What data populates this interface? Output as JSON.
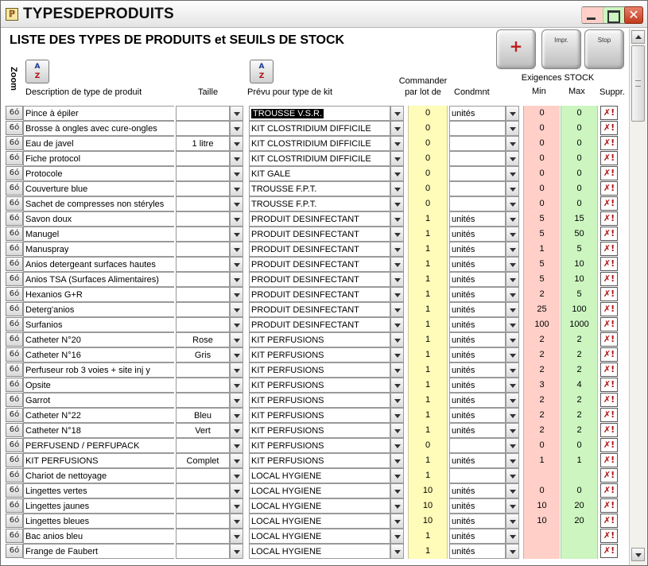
{
  "window": {
    "title": "TYPESDEPRODUITS",
    "close_glyph": "✕"
  },
  "header": {
    "title": "LISTE DES TYPES DE PRODUITS et SEUILS DE STOCK",
    "add_label": "+",
    "print_label": "Impr.",
    "stop_label": "Stop"
  },
  "columns": {
    "zoom": "Zoom",
    "description": "Description de type de produit",
    "taille": "Taille",
    "kit": "Prévu pour type de kit",
    "commander_1": "Commander",
    "commander_2": "par lot de",
    "condmnt": "Condmnt",
    "exigences": "Exigences STOCK",
    "min": "Min",
    "max": "Max",
    "suppr": "Suppr."
  },
  "icons": {
    "zoom_glasses": "glasses-icon",
    "sort": "sort-az-icon",
    "delete": "delete-x-icon",
    "add": "plus-icon"
  },
  "colors": {
    "command_bg": "#fffbb8",
    "min_bg": "#ffcfc8",
    "max_bg": "#ccf5c0",
    "kit_highlight": "#000000"
  },
  "rows": [
    {
      "desc": "Pince à épiler",
      "taille": "",
      "kit": "TROUSSE V.S.R.",
      "cmd": "0",
      "cond": "unités",
      "min": "0",
      "max": "0",
      "selected": true
    },
    {
      "desc": "Brosse à ongles avec cure-ongles",
      "taille": "",
      "kit": "KIT CLOSTRIDIUM DIFFICILE",
      "cmd": "0",
      "cond": "",
      "min": "0",
      "max": "0"
    },
    {
      "desc": "Eau de javel",
      "taille": "1 litre",
      "kit": "KIT CLOSTRIDIUM DIFFICILE",
      "cmd": "0",
      "cond": "",
      "min": "0",
      "max": "0"
    },
    {
      "desc": "Fiche protocol",
      "taille": "",
      "kit": "KIT CLOSTRIDIUM DIFFICILE",
      "cmd": "0",
      "cond": "",
      "min": "0",
      "max": "0"
    },
    {
      "desc": "Protocole",
      "taille": "",
      "kit": "KIT GALE",
      "cmd": "0",
      "cond": "",
      "min": "0",
      "max": "0"
    },
    {
      "desc": "Couverture blue",
      "taille": "",
      "kit": "TROUSSE F.P.T.",
      "cmd": "0",
      "cond": "",
      "min": "0",
      "max": "0"
    },
    {
      "desc": "Sachet de compresses non stéryles",
      "taille": "",
      "kit": "TROUSSE F.P.T.",
      "cmd": "0",
      "cond": "",
      "min": "0",
      "max": "0"
    },
    {
      "desc": "Savon doux",
      "taille": "",
      "kit": "PRODUIT  DESINFECTANT",
      "cmd": "1",
      "cond": "unités",
      "min": "5",
      "max": "15"
    },
    {
      "desc": "Manugel",
      "taille": "",
      "kit": "PRODUIT  DESINFECTANT",
      "cmd": "1",
      "cond": "unités",
      "min": "5",
      "max": "50"
    },
    {
      "desc": "Manuspray",
      "taille": "",
      "kit": "PRODUIT  DESINFECTANT",
      "cmd": "1",
      "cond": "unités",
      "min": "1",
      "max": "5"
    },
    {
      "desc": "Anios detergeant surfaces hautes",
      "taille": "",
      "kit": "PRODUIT  DESINFECTANT",
      "cmd": "1",
      "cond": "unités",
      "min": "5",
      "max": "10"
    },
    {
      "desc": "Anios TSA (Surfaces Alimentaires)",
      "taille": "",
      "kit": "PRODUIT  DESINFECTANT",
      "cmd": "1",
      "cond": "unités",
      "min": "5",
      "max": "10"
    },
    {
      "desc": "Hexanios        G+R",
      "taille": "",
      "kit": "PRODUIT  DESINFECTANT",
      "cmd": "1",
      "cond": "unités",
      "min": "2",
      "max": "5"
    },
    {
      "desc": "Deterg'anios",
      "taille": "",
      "kit": "PRODUIT  DESINFECTANT",
      "cmd": "1",
      "cond": "unités",
      "min": "25",
      "max": "100"
    },
    {
      "desc": "Surfanios",
      "taille": "",
      "kit": "PRODUIT  DESINFECTANT",
      "cmd": "1",
      "cond": "unités",
      "min": "100",
      "max": "1000"
    },
    {
      "desc": "Catheter N°20",
      "taille": "Rose",
      "kit": "KIT PERFUSIONS",
      "cmd": "1",
      "cond": "unités",
      "min": "2",
      "max": "2"
    },
    {
      "desc": "Catheter N°16",
      "taille": "Gris",
      "kit": "KIT PERFUSIONS",
      "cmd": "1",
      "cond": "unités",
      "min": "2",
      "max": "2"
    },
    {
      "desc": "Perfuseur rob 3 voies + site inj y",
      "taille": "",
      "kit": "KIT PERFUSIONS",
      "cmd": "1",
      "cond": "unités",
      "min": "2",
      "max": "2"
    },
    {
      "desc": "Opsite",
      "taille": "",
      "kit": "KIT PERFUSIONS",
      "cmd": "1",
      "cond": "unités",
      "min": "3",
      "max": "4"
    },
    {
      "desc": "Garrot",
      "taille": "",
      "kit": "KIT PERFUSIONS",
      "cmd": "1",
      "cond": "unités",
      "min": "2",
      "max": "2"
    },
    {
      "desc": "Catheter N°22",
      "taille": "Bleu",
      "kit": "KIT PERFUSIONS",
      "cmd": "1",
      "cond": "unités",
      "min": "2",
      "max": "2"
    },
    {
      "desc": "Catheter N°18",
      "taille": "Vert",
      "kit": "KIT PERFUSIONS",
      "cmd": "1",
      "cond": "unités",
      "min": "2",
      "max": "2"
    },
    {
      "desc": "PERFUSEND / PERFUPACK",
      "taille": "",
      "kit": "KIT PERFUSIONS",
      "cmd": "0",
      "cond": "",
      "min": "0",
      "max": "0"
    },
    {
      "desc": "KIT PERFUSIONS",
      "taille": "Complet",
      "kit": "KIT PERFUSIONS",
      "cmd": "1",
      "cond": "unités",
      "min": "1",
      "max": "1"
    },
    {
      "desc": "Chariot de nettoyage",
      "taille": "",
      "kit": "LOCAL HYGIENE",
      "cmd": "1",
      "cond": "",
      "min": "",
      "max": ""
    },
    {
      "desc": "Lingettes vertes",
      "taille": "",
      "kit": "LOCAL HYGIENE",
      "cmd": "10",
      "cond": "unités",
      "min": "0",
      "max": "0"
    },
    {
      "desc": "Lingettes jaunes",
      "taille": "",
      "kit": "LOCAL HYGIENE",
      "cmd": "10",
      "cond": "unités",
      "min": "10",
      "max": "20"
    },
    {
      "desc": "Lingettes bleues",
      "taille": "",
      "kit": "LOCAL HYGIENE",
      "cmd": "10",
      "cond": "unités",
      "min": "10",
      "max": "20"
    },
    {
      "desc": "Bac anios bleu",
      "taille": "",
      "kit": "LOCAL HYGIENE",
      "cmd": "1",
      "cond": "unités",
      "min": "",
      "max": ""
    },
    {
      "desc": "Frange de Faubert",
      "taille": "",
      "kit": "LOCAL HYGIENE",
      "cmd": "1",
      "cond": "unités",
      "min": "",
      "max": ""
    }
  ]
}
